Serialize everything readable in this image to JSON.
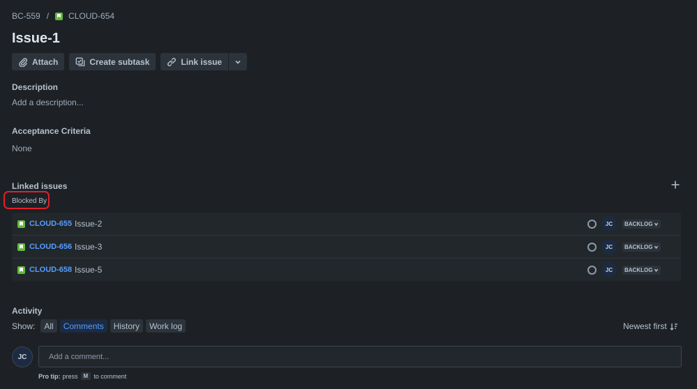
{
  "breadcrumb": {
    "parent": "BC-559",
    "separator": "/",
    "current": "CLOUD-654"
  },
  "issue": {
    "title": "Issue-1"
  },
  "toolbar": {
    "attach_label": "Attach",
    "create_subtask_label": "Create subtask",
    "link_issue_label": "Link issue"
  },
  "description": {
    "heading": "Description",
    "placeholder": "Add a description..."
  },
  "acceptance_criteria": {
    "heading": "Acceptance Criteria",
    "value": "None"
  },
  "linked_issues": {
    "heading": "Linked issues",
    "group_label": "Blocked By",
    "items": [
      {
        "key": "CLOUD-655",
        "summary": "Issue-2",
        "assignee_initials": "JC",
        "status": "BACKLOG"
      },
      {
        "key": "CLOUD-656",
        "summary": "Issue-3",
        "assignee_initials": "JC",
        "status": "BACKLOG"
      },
      {
        "key": "CLOUD-658",
        "summary": "Issue-5",
        "assignee_initials": "JC",
        "status": "BACKLOG"
      }
    ]
  },
  "activity": {
    "heading": "Activity",
    "show_label": "Show:",
    "filters": [
      "All",
      "Comments",
      "History",
      "Work log"
    ],
    "active_filter": "Comments",
    "sort_label": "Newest first",
    "comment_avatar_initials": "JC",
    "comment_placeholder": "Add a comment...",
    "pro_tip": {
      "prefix": "Pro tip:",
      "press": "press",
      "key": "M",
      "suffix": "to comment"
    }
  },
  "colors": {
    "background": "#1d2125",
    "link": "#579dff",
    "story_icon": "#63ba3c",
    "highlight_box": "#e2202a"
  },
  "icons": {
    "story": "story-icon",
    "attach": "paperclip-icon",
    "subtask": "subtask-icon",
    "link": "link-icon",
    "more": "chevron-down-icon",
    "add": "plus-icon",
    "status": "status-circle-icon",
    "sort": "sort-descending-icon"
  }
}
